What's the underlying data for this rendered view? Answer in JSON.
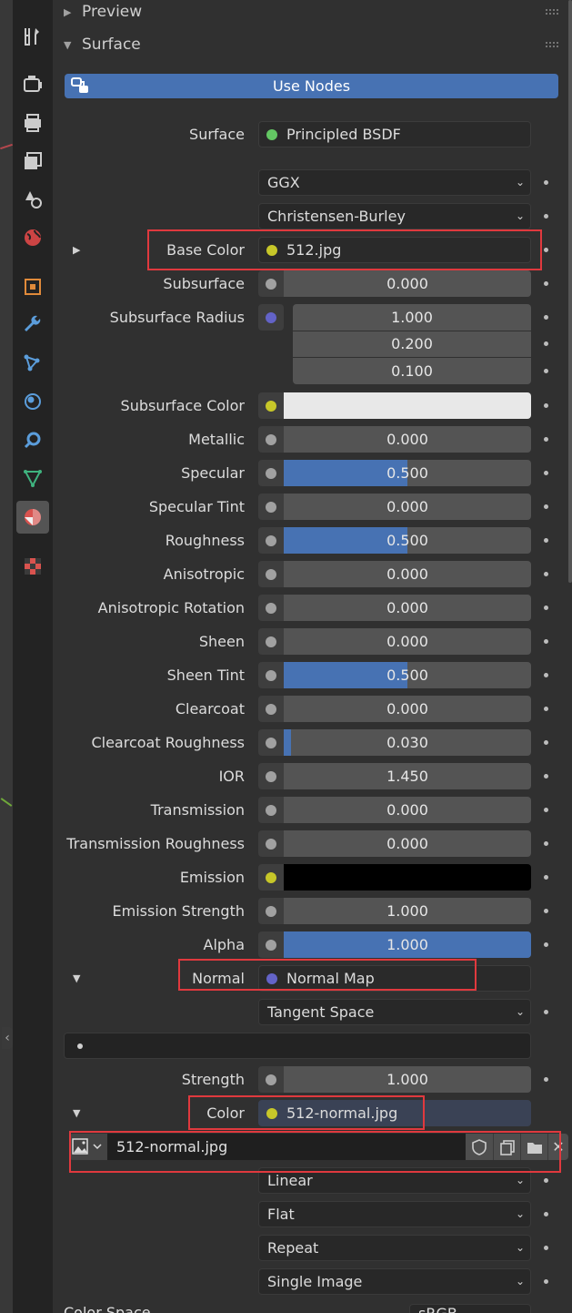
{
  "sections": {
    "preview": "Preview",
    "surface": "Surface"
  },
  "use_nodes_label": "Use Nodes",
  "surface_row": {
    "label": "Surface",
    "value": "Principled BSDF"
  },
  "distribution": "GGX",
  "subsurface_method": "Christensen-Burley",
  "base_color": {
    "label": "Base Color",
    "value": "512.jpg"
  },
  "subsurface": {
    "label": "Subsurface",
    "value": "0.000"
  },
  "subsurface_radius": {
    "label": "Subsurface Radius",
    "values": [
      "1.000",
      "0.200",
      "0.100"
    ]
  },
  "subsurface_color": {
    "label": "Subsurface Color",
    "color": "#e8e8e8"
  },
  "params": [
    {
      "label": "Metallic",
      "value": "0.000",
      "fraction": 0
    },
    {
      "label": "Specular",
      "value": "0.500",
      "fraction": 0.5
    },
    {
      "label": "Specular Tint",
      "value": "0.000",
      "fraction": 0
    },
    {
      "label": "Roughness",
      "value": "0.500",
      "fraction": 0.5
    },
    {
      "label": "Anisotropic",
      "value": "0.000",
      "fraction": 0
    },
    {
      "label": "Anisotropic Rotation",
      "value": "0.000",
      "fraction": 0
    },
    {
      "label": "Sheen",
      "value": "0.000",
      "fraction": 0
    },
    {
      "label": "Sheen Tint",
      "value": "0.500",
      "fraction": 0.5
    },
    {
      "label": "Clearcoat",
      "value": "0.000",
      "fraction": 0
    },
    {
      "label": "Clearcoat Roughness",
      "value": "0.030",
      "fraction": 0.03
    },
    {
      "label": "IOR",
      "value": "1.450",
      "fraction": 0
    },
    {
      "label": "Transmission",
      "value": "0.000",
      "fraction": 0
    },
    {
      "label": "Transmission Roughness",
      "value": "0.000",
      "fraction": 0
    }
  ],
  "emission": {
    "label": "Emission",
    "color": "#000000"
  },
  "emission_strength": {
    "label": "Emission Strength",
    "value": "1.000"
  },
  "alpha": {
    "label": "Alpha",
    "value": "1.000",
    "fraction": 1.0
  },
  "normal": {
    "label": "Normal",
    "value": "Normal Map"
  },
  "normal_space": "Tangent Space",
  "strength": {
    "label": "Strength",
    "value": "1.000"
  },
  "color_input": {
    "label": "Color",
    "value": "512-normal.jpg"
  },
  "image_name": "512-normal.jpg",
  "interpolation": "Linear",
  "projection": "Flat",
  "extension": "Repeat",
  "source": "Single Image",
  "color_space": {
    "label": "Color Space",
    "value": "sRGB"
  },
  "colors": {
    "accent": "#4772b3",
    "highlight": "#e0393e",
    "socket_gray": "#a1a1a1",
    "socket_yellow": "#c7c729",
    "socket_purple": "#6363c7",
    "socket_green": "#63c763"
  },
  "tabs": [
    "tool-icon",
    "render-icon",
    "output-icon",
    "view-layer-icon",
    "scene-icon",
    "world-icon",
    "object-icon",
    "modifier-icon",
    "particles-icon",
    "physics-icon",
    "constraints-icon",
    "data-icon",
    "material-icon",
    "texture-icon"
  ]
}
